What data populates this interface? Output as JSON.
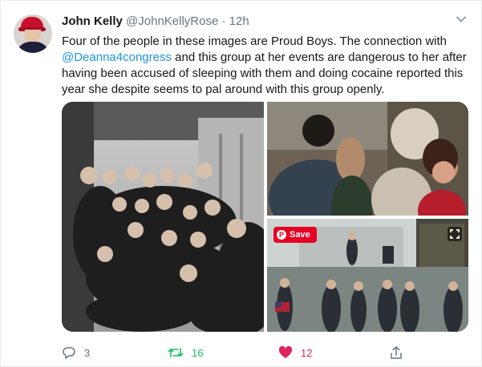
{
  "tweet": {
    "author_name": "John Kelly",
    "author_handle": "@JohnKellyRose",
    "separator": "·",
    "time": "12h",
    "text_lines": [
      "Four of the people in these images are Proud Boys. The connection with",
      "and this group at her events are dangerous to her after",
      "having been accused of sleeping with them and doing cocaine reported this",
      "year she despite seems to pal around with this group openly."
    ],
    "mention": "@Deanna4congress"
  },
  "media": {
    "save_label": "Save",
    "pin_glyph": "P"
  },
  "actions": {
    "reply_count": "3",
    "retweet_count": "16",
    "like_count": "12"
  },
  "colors": {
    "link": "#1b95e0",
    "retweet": "#17bf63",
    "like": "#e0245e",
    "muted": "#657786",
    "pinterest": "#e60023"
  },
  "icons": [
    "avatar",
    "caret-down-icon",
    "pinterest-save-icon",
    "expand-icon",
    "reply-icon",
    "retweet-icon",
    "like-icon",
    "share-icon"
  ]
}
